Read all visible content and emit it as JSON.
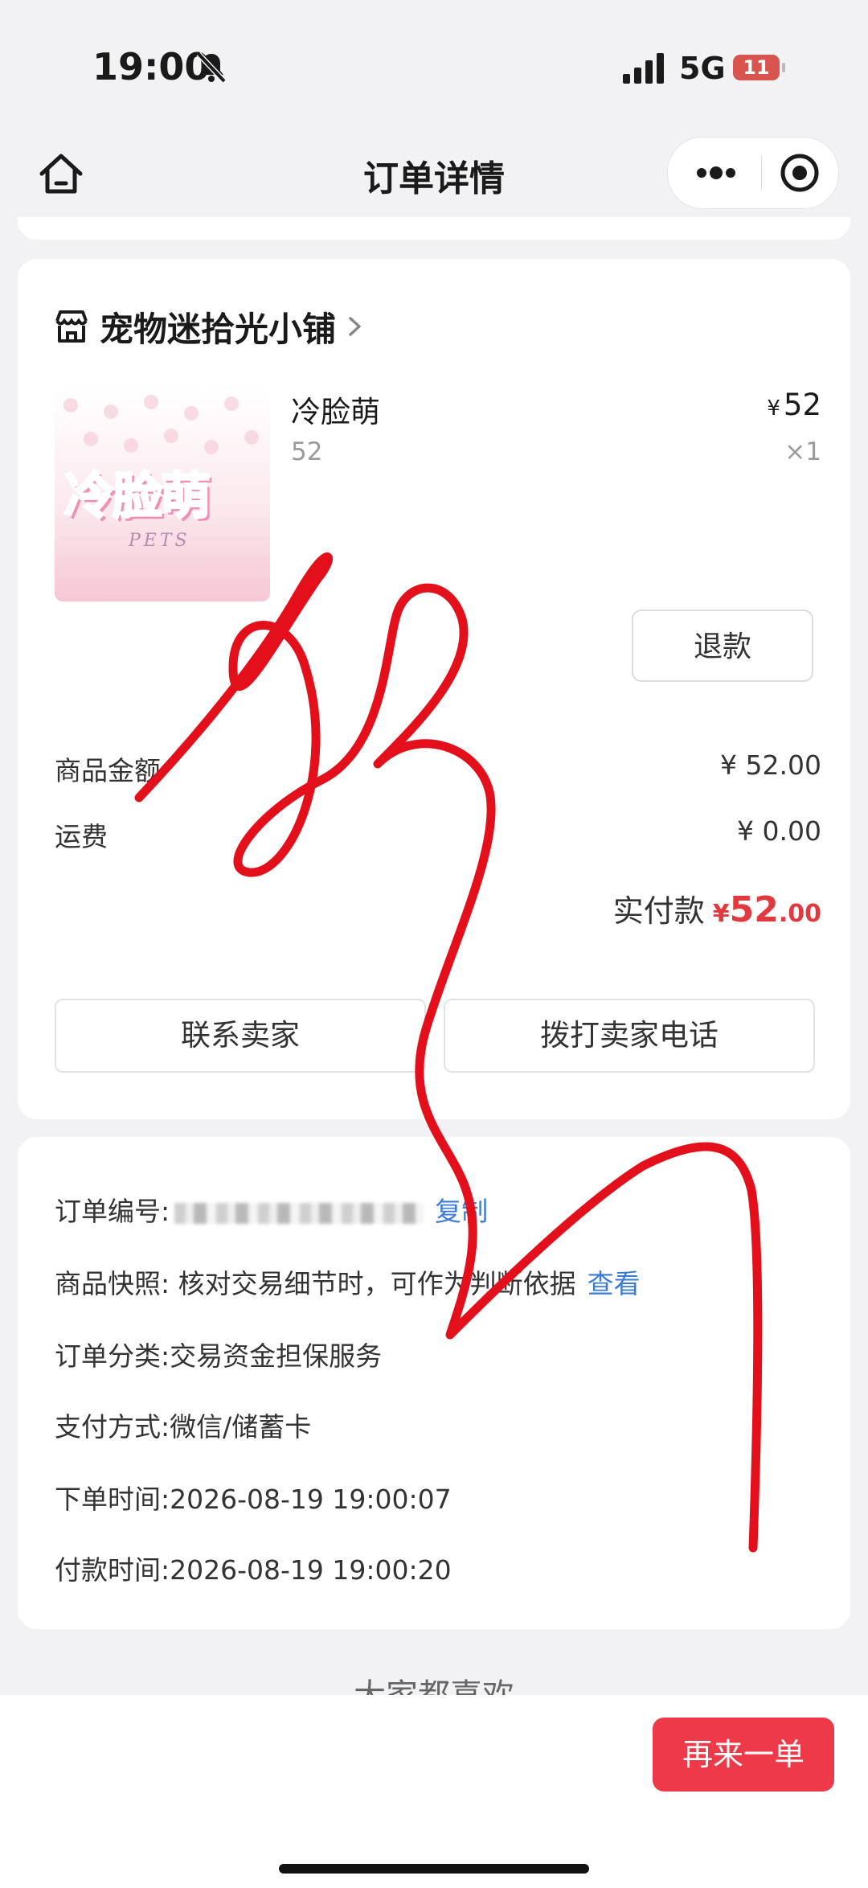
{
  "status": {
    "time": "19:00",
    "network": "5G",
    "battery": "11"
  },
  "nav": {
    "title": "订单详情"
  },
  "shop": {
    "name": "宠物迷拾光小铺"
  },
  "product": {
    "name": "冷脸萌",
    "spec": "52",
    "price_symbol": "¥",
    "price": "52",
    "qty": "×1",
    "thumb_logo": "冷脸萌",
    "thumb_sub": "PETS"
  },
  "actions": {
    "refund": "退款",
    "contact": "联系卖家",
    "call": "拨打卖家电话"
  },
  "amounts": {
    "goods_label": "商品金额",
    "goods_value": "¥ 52.00",
    "shipping_label": "运费",
    "shipping_value": "¥ 0.00",
    "paid_label": "实付款",
    "paid_symbol": "¥",
    "paid_int": "52",
    "paid_dec": ".00"
  },
  "order": {
    "number_label": "订单编号:",
    "copy": "复制",
    "snapshot_text": "商品快照: 核对交易细节时，可作为判断依据",
    "snapshot_link": "查看",
    "category": "订单分类:交易资金担保服务",
    "payment": "支付方式:微信/储蓄卡",
    "placed": "下单时间:2026-08-19 19:00:07",
    "paid": "付款时间:2026-08-19 19:00:20"
  },
  "footer": {
    "suggest": "大家都喜欢",
    "again": "再来一单"
  },
  "colors": {
    "accent": "#ee3a48",
    "link": "#3a7bd5",
    "price": "#e0393e",
    "scribble": "#e3101c"
  },
  "icons": [
    "bell-slash-icon",
    "signal-icon",
    "battery-icon",
    "home-icon",
    "more-icon",
    "target-icon",
    "shop-icon",
    "chevron-right-icon"
  ]
}
